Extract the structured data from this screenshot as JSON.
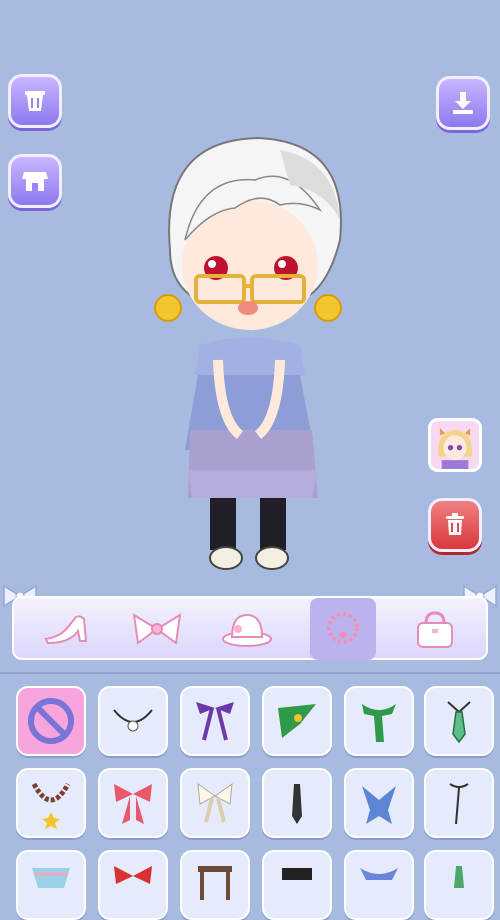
{
  "game": {
    "title": "",
    "left_buttons": [
      "trash-bin-icon",
      "shop-icon"
    ],
    "right_buttons": [
      "download-icon",
      "character-avatar-button",
      "reset-icon"
    ]
  },
  "category_tabs": [
    {
      "name": "shoes",
      "icon": "high-heel-icon",
      "selected": false
    },
    {
      "name": "bows",
      "icon": "bow-icon",
      "selected": false
    },
    {
      "name": "hats",
      "icon": "hat-icon",
      "selected": false
    },
    {
      "name": "necklaces",
      "icon": "necklace-icon",
      "selected": true
    },
    {
      "name": "bags",
      "icon": "handbag-icon",
      "selected": false
    }
  ],
  "item_grid": {
    "rows": [
      [
        "none-icon",
        "pearl-necklace-icon",
        "ribbon-tie-purple-icon",
        "green-scarf-icon",
        "green-scarf-long-icon",
        "green-tie-icon"
      ],
      [
        "bead-necklace-star-icon",
        "pink-bow-icon",
        "white-bow-icon",
        "black-tie-icon",
        "blue-scarf-icon",
        "black-cord-necklace-icon"
      ],
      [
        "striped-scarf-icon",
        "red-bow-icon",
        "brown-strap-icon",
        "black-collar-icon",
        "blue-scarf-icon",
        "green-tie-icon"
      ]
    ]
  },
  "colors": {
    "background": "#a7bbe0",
    "button_purple": "#9a84f3",
    "button_red": "#e0474b",
    "selected_cell": "#f7a6dd",
    "active_tab": "#bcb3ee"
  }
}
